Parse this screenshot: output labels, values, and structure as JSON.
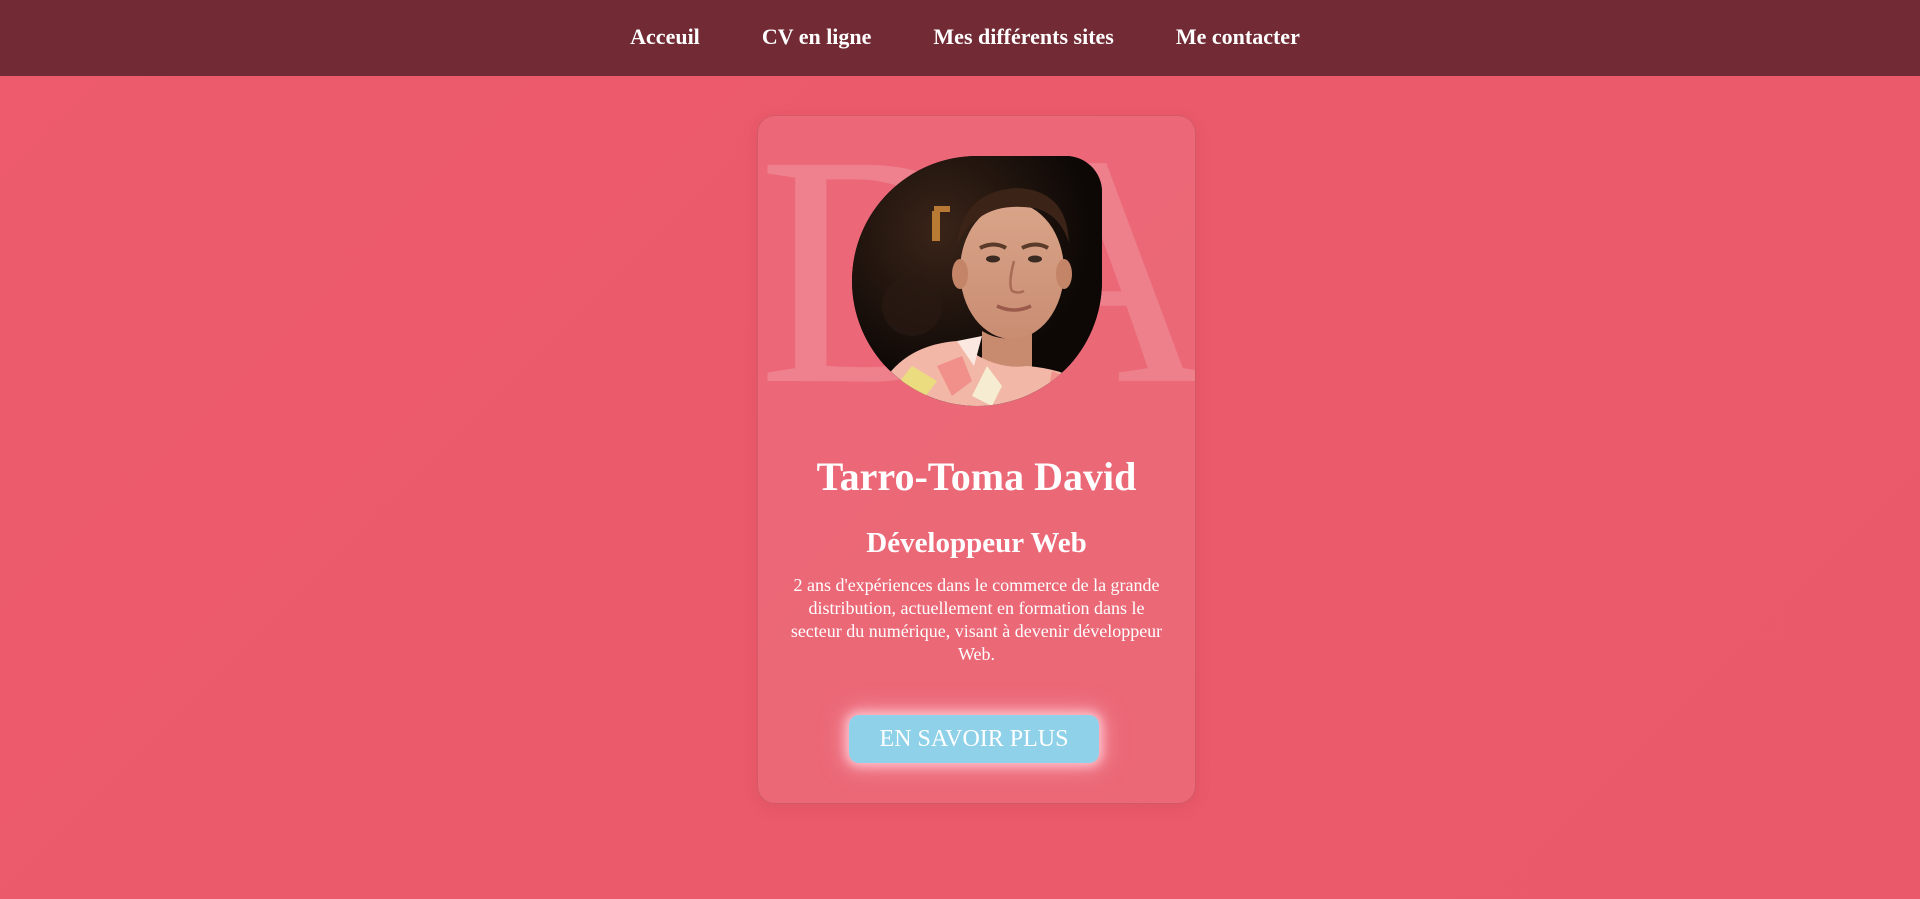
{
  "nav": {
    "items": [
      {
        "label": "Acceuil"
      },
      {
        "label": "CV en ligne"
      },
      {
        "label": "Mes différents sites"
      },
      {
        "label": "Me contacter"
      }
    ]
  },
  "card": {
    "monogram": "DA",
    "photo_alt": "Portrait photo",
    "name": "Tarro-Toma David",
    "role": "Développeur Web",
    "description": "2 ans d'expériences dans le commerce de la grande distribution, actuellement en formation dans le secteur du numérique, visant à devenir développeur Web.",
    "cta_label": "EN SAVOIR PLUS"
  },
  "colors": {
    "background": "#ea5a6a",
    "nav_background": "#722b35",
    "button": "#8ed1e9",
    "text": "#ffffff"
  }
}
